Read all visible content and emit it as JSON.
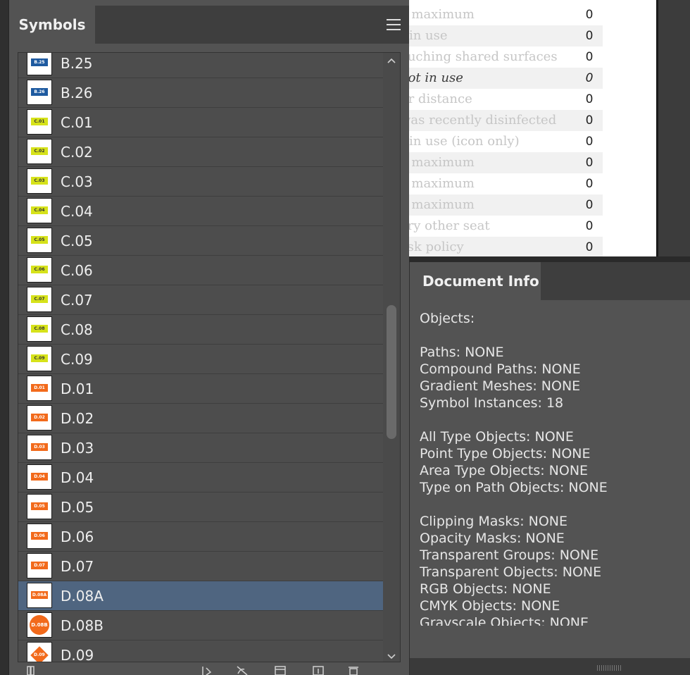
{
  "artboard": {
    "rows": [
      {
        "label": "e maximum",
        "value": "0",
        "shade": false,
        "emph": false
      },
      {
        "label": "t in use",
        "value": "0",
        "shade": true,
        "emph": false
      },
      {
        "label": "ouching shared surfaces",
        "value": "0",
        "shade": false,
        "emph": false
      },
      {
        "label": "not in use",
        "value": "0",
        "shade": true,
        "emph": true
      },
      {
        "label": "ur distance",
        "value": "0",
        "shade": false,
        "emph": false
      },
      {
        "label": "was recently disinfected",
        "value": "0",
        "shade": true,
        "emph": false
      },
      {
        "label": "t in use (icon only)",
        "value": "0",
        "shade": false,
        "emph": false
      },
      {
        "label": "e maximum",
        "value": "0",
        "shade": true,
        "emph": false
      },
      {
        "label": "e maximum",
        "value": "0",
        "shade": false,
        "emph": false
      },
      {
        "label": "e maximum",
        "value": "0",
        "shade": true,
        "emph": false
      },
      {
        "label": "ery other seat",
        "value": "0",
        "shade": false,
        "emph": false
      },
      {
        "label": "esk policy",
        "value": "0",
        "shade": true,
        "emph": false
      }
    ]
  },
  "symbols_panel": {
    "title": "Symbols",
    "menu_icon": "hamburger-menu-icon",
    "items": [
      {
        "name": "B.25",
        "thumb": "B.25",
        "bg": "#1e5aa0",
        "fg": "#ffffff",
        "shape": "rect"
      },
      {
        "name": "B.26",
        "thumb": "B.26",
        "bg": "#1e5aa0",
        "fg": "#ffffff",
        "shape": "rect"
      },
      {
        "name": "C.01",
        "thumb": "C.01",
        "bg": "#d6e21a",
        "fg": "#333333",
        "shape": "rect"
      },
      {
        "name": "C.02",
        "thumb": "C.02",
        "bg": "#d6e21a",
        "fg": "#333333",
        "shape": "rect"
      },
      {
        "name": "C.03",
        "thumb": "C.03",
        "bg": "#d6e21a",
        "fg": "#333333",
        "shape": "rect"
      },
      {
        "name": "C.04",
        "thumb": "C.04",
        "bg": "#d6e21a",
        "fg": "#333333",
        "shape": "rect"
      },
      {
        "name": "C.05",
        "thumb": "C.05",
        "bg": "#d6e21a",
        "fg": "#333333",
        "shape": "rect"
      },
      {
        "name": "C.06",
        "thumb": "C.06",
        "bg": "#d6e21a",
        "fg": "#333333",
        "shape": "rect"
      },
      {
        "name": "C.07",
        "thumb": "C.07",
        "bg": "#d6e21a",
        "fg": "#333333",
        "shape": "rect"
      },
      {
        "name": "C.08",
        "thumb": "C.08",
        "bg": "#d6e21a",
        "fg": "#333333",
        "shape": "rect"
      },
      {
        "name": "C.09",
        "thumb": "C.09",
        "bg": "#d6e21a",
        "fg": "#333333",
        "shape": "rect"
      },
      {
        "name": "D.01",
        "thumb": "D.01",
        "bg": "#f26a1b",
        "fg": "#ffffff",
        "shape": "rect"
      },
      {
        "name": "D.02",
        "thumb": "D.02",
        "bg": "#f26a1b",
        "fg": "#ffffff",
        "shape": "rect"
      },
      {
        "name": "D.03",
        "thumb": "D.03",
        "bg": "#f26a1b",
        "fg": "#ffffff",
        "shape": "rect"
      },
      {
        "name": "D.04",
        "thumb": "D.04",
        "bg": "#f26a1b",
        "fg": "#ffffff",
        "shape": "rect"
      },
      {
        "name": "D.05",
        "thumb": "D.05",
        "bg": "#f26a1b",
        "fg": "#ffffff",
        "shape": "rect"
      },
      {
        "name": "D.06",
        "thumb": "D.06",
        "bg": "#f26a1b",
        "fg": "#ffffff",
        "shape": "rect"
      },
      {
        "name": "D.07",
        "thumb": "D.07",
        "bg": "#f26a1b",
        "fg": "#ffffff",
        "shape": "rect"
      },
      {
        "name": "D.08A",
        "thumb": "D.08A",
        "bg": "#f26a1b",
        "fg": "#ffffff",
        "shape": "rect",
        "selected": true
      },
      {
        "name": "D.08B",
        "thumb": "D.08B",
        "bg": "#f26a1b",
        "fg": "#ffffff",
        "shape": "circle"
      },
      {
        "name": "D.09",
        "thumb": "D.09",
        "bg": "#f26a1b",
        "fg": "#ffffff",
        "shape": "diamond"
      }
    ],
    "footer_tools": [
      "symbol-libraries-menu-icon",
      "place-symbol-instance-icon",
      "break-link-icon",
      "symbol-options-icon",
      "new-symbol-icon",
      "delete-symbol-icon"
    ]
  },
  "document_info": {
    "title": "Document Info",
    "lines": [
      "Objects:",
      "",
      "Paths: NONE",
      "Compound Paths: NONE",
      "Gradient Meshes: NONE",
      "Symbol Instances: 18",
      "",
      "All Type Objects: NONE",
      "Point Type Objects: NONE",
      "Area Type Objects: NONE",
      "Type on Path Objects: NONE",
      "",
      "Clipping Masks: NONE",
      "Opacity Masks: NONE",
      "Transparent Groups: NONE",
      "Transparent Objects: NONE",
      "RGB Objects: NONE",
      "CMYK Objects: NONE",
      "Grayscale Objects: NONE"
    ]
  },
  "colors": {
    "panel_bg": "#535353",
    "selection": "#4f6580",
    "blue_tag": "#1e5aa0",
    "yellow_tag": "#d6e21a",
    "orange_tag": "#f26a1b"
  }
}
